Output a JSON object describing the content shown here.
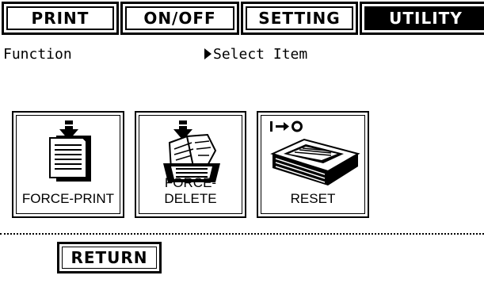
{
  "tabs": [
    {
      "label": "PRINT",
      "active": false
    },
    {
      "label": "ON/OFF",
      "active": false
    },
    {
      "label": "SETTING",
      "active": false
    },
    {
      "label": "UTILITY",
      "active": true
    }
  ],
  "header": {
    "left": "Function",
    "right": "Select Item"
  },
  "functions": [
    {
      "label": "FORCE-PRINT",
      "icon": "force-print-icon"
    },
    {
      "label": "FORCE-DELETE",
      "icon": "force-delete-icon"
    },
    {
      "label": "RESET",
      "icon": "reset-icon",
      "icon_caption": "I→O"
    }
  ],
  "footer": {
    "return_label": "RETURN"
  }
}
